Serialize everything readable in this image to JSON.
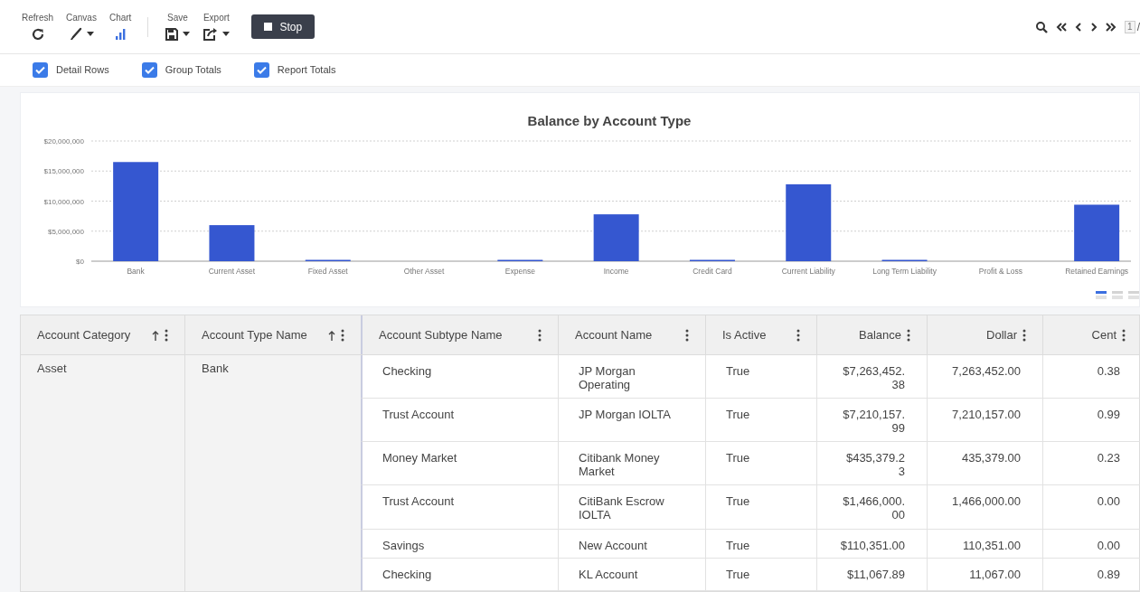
{
  "toolbar": {
    "tools": [
      {
        "label": "Refresh",
        "kind": "refresh",
        "dropdown": false,
        "selected": false
      },
      {
        "label": "Canvas",
        "kind": "brush",
        "dropdown": true,
        "selected": false
      },
      {
        "label": "Chart",
        "kind": "chart",
        "dropdown": false,
        "selected": true
      },
      {
        "label": "Save",
        "kind": "save",
        "dropdown": true,
        "selected": false
      },
      {
        "label": "Export",
        "kind": "export",
        "dropdown": true,
        "selected": false
      }
    ],
    "stop_button": "Stop",
    "pager": {
      "page": "1",
      "separator": "/"
    }
  },
  "options": [
    {
      "label": "Detail Rows",
      "checked": true
    },
    {
      "label": "Group Totals",
      "checked": true
    },
    {
      "label": "Report Totals",
      "checked": true
    }
  ],
  "chart": {
    "chart_data": {
      "type": "bar",
      "title": "Balance by Account Type",
      "categories": [
        "Bank",
        "Current Asset",
        "Fixed Asset",
        "Other Asset",
        "Expense",
        "Income",
        "Credit Card",
        "Current Liability",
        "Long Term Liability",
        "Profit & Loss",
        "Retained Earnings"
      ],
      "grid": true,
      "series": [
        {
          "color": "#3557d0",
          "values": [
            16500000,
            6000000,
            100000,
            0,
            100000,
            7800000,
            100000,
            12800000,
            100000,
            0,
            9400000
          ]
        }
      ],
      "ylim": [
        0,
        20000000
      ],
      "yticks": [
        {
          "value": 0,
          "label": "$0"
        },
        {
          "value": 5000000,
          "label": "$5,000,000"
        },
        {
          "value": 10000000,
          "label": "$10,000,000"
        },
        {
          "value": 15000000,
          "label": "$15,000,000"
        },
        {
          "value": 20000000,
          "label": "$20,000,000"
        }
      ]
    },
    "views": [
      {
        "selected": true
      },
      {
        "selected": false
      },
      {
        "selected": false
      }
    ]
  },
  "table": {
    "columns": [
      {
        "label": "Account Category",
        "sorted": true,
        "kind": "text"
      },
      {
        "label": "Account Type Name",
        "sorted": true,
        "kind": "text"
      },
      {
        "label": "Account Subtype Name",
        "sorted": false,
        "kind": "text"
      },
      {
        "label": "Account Name",
        "sorted": false,
        "kind": "text"
      },
      {
        "label": "Is Active",
        "sorted": false,
        "kind": "text"
      },
      {
        "label": "Balance",
        "sorted": false,
        "kind": "number"
      },
      {
        "label": "Dollar",
        "sorted": false,
        "kind": "number"
      },
      {
        "label": "Cent",
        "sorted": false,
        "kind": "number"
      }
    ],
    "groups": [
      {
        "category": "Asset",
        "type_name": "Bank",
        "rows": [
          [
            "Checking",
            "JP Morgan Operating",
            "True",
            "$7,263,452.38",
            "7,263,452.00",
            "0.38"
          ],
          [
            "Trust Account",
            "JP Morgan IOLTA",
            "True",
            "$7,210,157.99",
            "7,210,157.00",
            "0.99"
          ],
          [
            "Money Market",
            "Citibank Money Market",
            "True",
            "$435,379.23",
            "435,379.00",
            "0.23"
          ],
          [
            "Trust Account",
            "CitiBank Escrow IOLTA",
            "True",
            "$1,466,000.00",
            "1,466,000.00",
            "0.00"
          ],
          [
            "Savings",
            "New Account",
            "True",
            "$110,351.00",
            "110,351.00",
            "0.00"
          ],
          [
            "Checking",
            "KL Account",
            "True",
            "$11,067.89",
            "11,067.00",
            "0.89"
          ]
        ]
      }
    ]
  }
}
